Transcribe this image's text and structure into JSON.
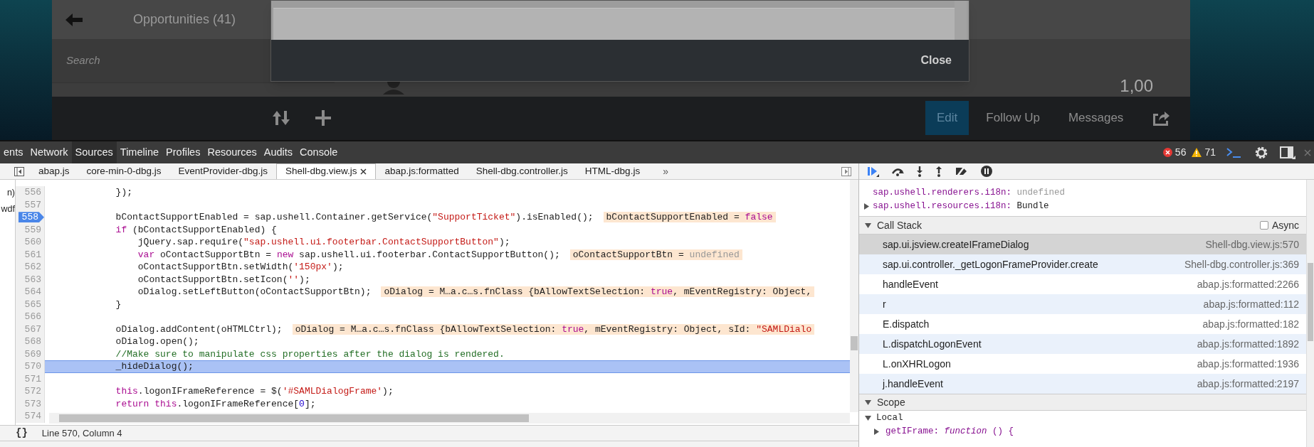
{
  "app": {
    "title": "Opportunities (41)",
    "search": {
      "placeholder": "Search"
    },
    "dialog": {
      "button": "Close"
    },
    "amount": "1,00",
    "footer_actions": [
      {
        "label": "Edit",
        "selected": true
      },
      {
        "label": "Follow Up",
        "selected": false
      },
      {
        "label": "Messages",
        "selected": false
      }
    ]
  },
  "devtools": {
    "panels": [
      {
        "label": "ents",
        "selected": false
      },
      {
        "label": "Network",
        "selected": false
      },
      {
        "label": "Sources",
        "selected": true
      },
      {
        "label": "Timeline",
        "selected": false
      },
      {
        "label": "Profiles",
        "selected": false
      },
      {
        "label": "Resources",
        "selected": false
      },
      {
        "label": "Audits",
        "selected": false
      },
      {
        "label": "Console",
        "selected": false
      }
    ],
    "errors": "56",
    "warnings": "71"
  },
  "navigator": {
    "items": [
      "n)",
      "wdf"
    ]
  },
  "files": {
    "tabs": [
      {
        "label": "abap.js",
        "selected": false,
        "closable": false
      },
      {
        "label": "core-min-0-dbg.js",
        "selected": false,
        "closable": false
      },
      {
        "label": "EventProvider-dbg.js",
        "selected": false,
        "closable": false
      },
      {
        "label": "Shell-dbg.view.js",
        "selected": true,
        "closable": true
      },
      {
        "label": "abap.js:formatted",
        "selected": false,
        "closable": false
      },
      {
        "label": "Shell-dbg.controller.js",
        "selected": false,
        "closable": false
      },
      {
        "label": "HTML-dbg.js",
        "selected": false,
        "closable": false
      }
    ],
    "overflow": "»"
  },
  "code": {
    "lines": [
      {
        "number": "556",
        "breakpoint": false,
        "current": false,
        "tokens": [
          {
            "kind": "plain",
            "text": "            });"
          }
        ]
      },
      {
        "number": "557",
        "breakpoint": false,
        "current": false
      },
      {
        "number": "558",
        "breakpoint": true,
        "current": false,
        "tokens": [
          {
            "kind": "plain",
            "text": "            bContactSupportEnabled = sap.ushell.Container.getService("
          },
          {
            "kind": "string",
            "text": "\"SupportTicket\""
          },
          {
            "kind": "plain",
            "text": ").isEnabled();"
          }
        ],
        "annotation": [
          {
            "kind": "plain",
            "text": "bContactSupportEnabled = "
          },
          {
            "kind": "keyword",
            "text": "false"
          }
        ]
      },
      {
        "number": "559",
        "breakpoint": false,
        "current": false,
        "tokens": [
          {
            "kind": "keyword",
            "text": "            if"
          },
          {
            "kind": "plain",
            "text": " (bContactSupportEnabled) {"
          }
        ]
      },
      {
        "number": "560",
        "breakpoint": false,
        "current": false,
        "tokens": [
          {
            "kind": "plain",
            "text": "                jQuery.sap.require("
          },
          {
            "kind": "string",
            "text": "\"sap.ushell.ui.footerbar.ContactSupportButton\""
          },
          {
            "kind": "plain",
            "text": ");"
          }
        ]
      },
      {
        "number": "561",
        "breakpoint": false,
        "current": false,
        "tokens": [
          {
            "kind": "keyword",
            "text": "                var"
          },
          {
            "kind": "plain",
            "text": " oContactSupportBtn = "
          },
          {
            "kind": "keyword",
            "text": "new"
          },
          {
            "kind": "plain",
            "text": " sap.ushell.ui.footerbar.ContactSupportButton();"
          }
        ],
        "annotation": [
          {
            "kind": "plain",
            "text": "oContactSupportBtn = "
          },
          {
            "kind": "muted",
            "text": "undefined"
          }
        ]
      },
      {
        "number": "562",
        "breakpoint": false,
        "current": false,
        "tokens": [
          {
            "kind": "plain",
            "text": "                oContactSupportBtn.setWidth("
          },
          {
            "kind": "string",
            "text": "'150px'"
          },
          {
            "kind": "plain",
            "text": ");"
          }
        ]
      },
      {
        "number": "563",
        "breakpoint": false,
        "current": false,
        "tokens": [
          {
            "kind": "plain",
            "text": "                oContactSupportBtn.setIcon("
          },
          {
            "kind": "string",
            "text": "''"
          },
          {
            "kind": "plain",
            "text": ");"
          }
        ]
      },
      {
        "number": "564",
        "breakpoint": false,
        "current": false,
        "tokens": [
          {
            "kind": "plain",
            "text": "                oDialog.setLeftButton(oContactSupportBtn);"
          }
        ],
        "annotation": [
          {
            "kind": "plain",
            "text": "oDialog = M…a.c…s.fnClass {bAllowTextSelection: "
          },
          {
            "kind": "keyword",
            "text": "true"
          },
          {
            "kind": "plain",
            "text": ", mEventRegistry: Object,"
          }
        ]
      },
      {
        "number": "565",
        "breakpoint": false,
        "current": false,
        "tokens": [
          {
            "kind": "plain",
            "text": "            }"
          }
        ]
      },
      {
        "number": "566",
        "breakpoint": false,
        "current": false
      },
      {
        "number": "567",
        "breakpoint": false,
        "current": false,
        "tokens": [
          {
            "kind": "plain",
            "text": "            oDialog.addContent(oHTMLCtrl);"
          }
        ],
        "annotation": [
          {
            "kind": "plain",
            "text": "oDialog = M…a.c…s.fnClass {bAllowTextSelection: "
          },
          {
            "kind": "keyword",
            "text": "true"
          },
          {
            "kind": "plain",
            "text": ", mEventRegistry: Object, sId: "
          },
          {
            "kind": "string",
            "text": "\"SAMLDialo"
          }
        ]
      },
      {
        "number": "568",
        "breakpoint": false,
        "current": false,
        "tokens": [
          {
            "kind": "plain",
            "text": "            oDialog.open();"
          }
        ]
      },
      {
        "number": "569",
        "breakpoint": false,
        "current": false,
        "tokens": [
          {
            "kind": "comment",
            "text": "            //Make sure to manipulate css properties after the dialog is rendered."
          }
        ]
      },
      {
        "number": "570",
        "breakpoint": false,
        "current": true,
        "tokens": [
          {
            "kind": "plain",
            "text": "            _hideDialog();"
          }
        ]
      },
      {
        "number": "571",
        "breakpoint": false,
        "current": false
      },
      {
        "number": "572",
        "breakpoint": false,
        "current": false,
        "tokens": [
          {
            "kind": "keyword",
            "text": "            this"
          },
          {
            "kind": "plain",
            "text": ".logonIFrameReference = $("
          },
          {
            "kind": "string",
            "text": "'#SAMLDialogFrame'"
          },
          {
            "kind": "plain",
            "text": ");"
          }
        ]
      },
      {
        "number": "573",
        "breakpoint": false,
        "current": false,
        "tokens": [
          {
            "kind": "keyword",
            "text": "            return this"
          },
          {
            "kind": "plain",
            "text": ".logonIFrameReference["
          },
          {
            "kind": "number",
            "text": "0"
          },
          {
            "kind": "plain",
            "text": "];"
          }
        ]
      },
      {
        "number": "574",
        "breakpoint": false,
        "current": false
      }
    ]
  },
  "status_bar": {
    "format_button": "{}",
    "position": "Line 570, Column 4"
  },
  "debugger": {
    "watch": [
      {
        "key": "sap.ushell.renderers.i18n:",
        "value": [
          {
            "kind": "muted",
            "text": "undefined"
          }
        ],
        "expandable": false
      },
      {
        "key": "sap.ushell.resources.i18n:",
        "value": [
          {
            "kind": "plain",
            "text": "Bundle"
          }
        ],
        "expandable": true
      }
    ],
    "call_stack": {
      "title": "Call Stack",
      "expanded": true,
      "async": {
        "label": "Async",
        "checked": false
      },
      "frames": [
        {
          "function": "sap.ui.jsview.createIFrameDialog",
          "location": "Shell-dbg.view.js:570",
          "selected": true
        },
        {
          "function": "sap.ui.controller._getLogonFrameProvider.create",
          "location": "Shell-dbg.controller.js:369",
          "selected": false
        },
        {
          "function": "handleEvent",
          "location": "abap.js:formatted:2266",
          "selected": false
        },
        {
          "function": "r",
          "location": "abap.js:formatted:112",
          "selected": false
        },
        {
          "function": "E.dispatch",
          "location": "abap.js:formatted:182",
          "selected": false
        },
        {
          "function": "L.dispatchLogonEvent",
          "location": "abap.js:formatted:1892",
          "selected": false
        },
        {
          "function": "L.onXHRLogon",
          "location": "abap.js:formatted:1936",
          "selected": false
        },
        {
          "function": "j.handleEvent",
          "location": "abap.js:formatted:2197",
          "selected": false
        }
      ]
    },
    "scope": {
      "title": "Scope",
      "expanded": true,
      "groups": [
        {
          "title": "Local",
          "expanded": true,
          "items": [
            {
              "key": "getIFrame:",
              "value": "*function* () {",
              "expandable": true
            }
          ]
        }
      ]
    }
  }
}
